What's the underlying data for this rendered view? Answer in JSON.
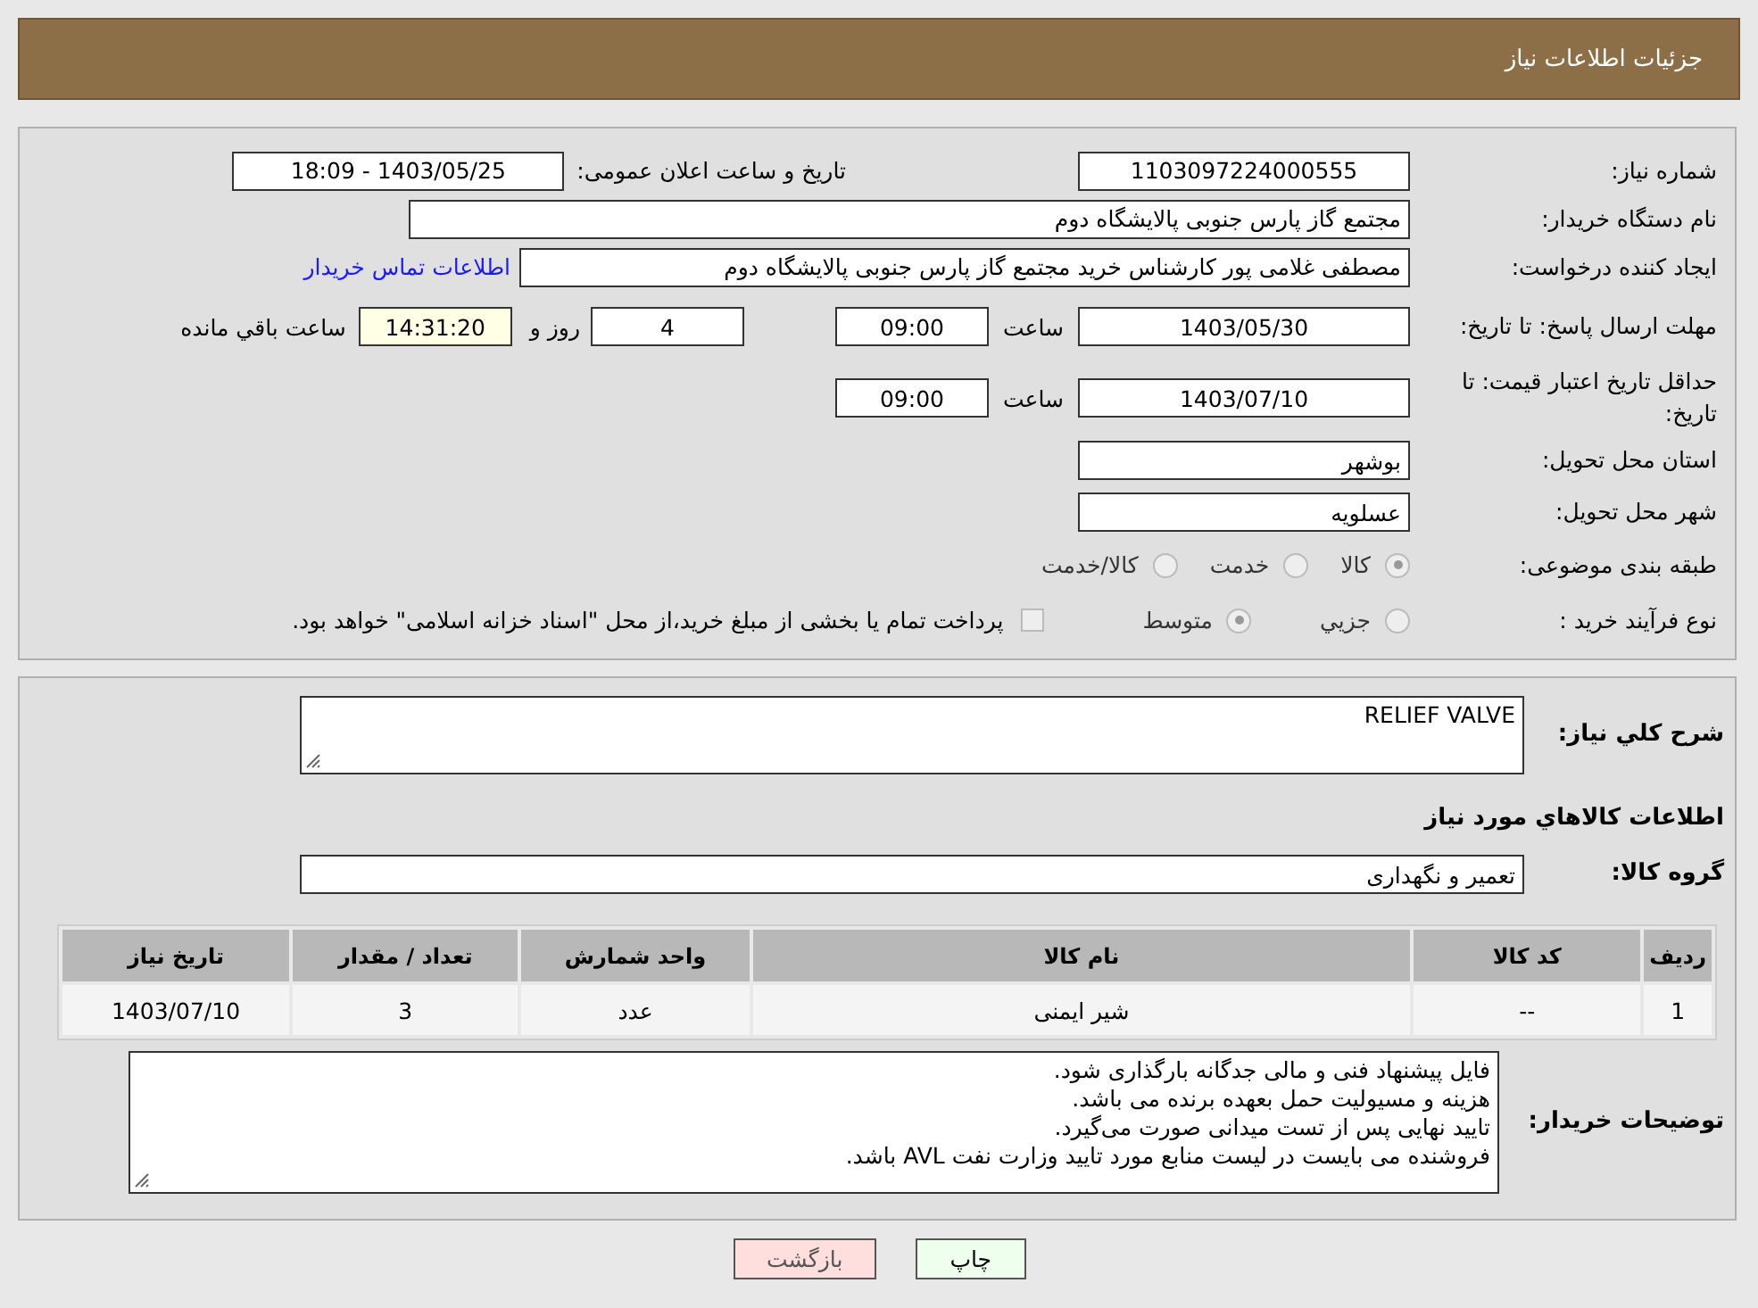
{
  "header": {
    "title": "جزئیات اطلاعات نیاز"
  },
  "details": {
    "need_number": {
      "label": "شماره نیاز:",
      "value": "1103097224000555"
    },
    "announce": {
      "label": "تاریخ و ساعت اعلان عمومی:",
      "value": "1403/05/25 - 18:09"
    },
    "buyer": {
      "label": "نام دستگاه خریدار:",
      "value": "مجتمع گاز پارس جنوبی  پالایشگاه دوم"
    },
    "creator": {
      "label": "ایجاد کننده درخواست:",
      "value": "مصطفی غلامی پور کارشناس خرید مجتمع گاز پارس جنوبی  پالایشگاه دوم",
      "link": "اطلاعات تماس خریدار"
    },
    "deadline": {
      "label": "مهلت ارسال پاسخ: تا تاریخ:",
      "date": "1403/05/30",
      "time_label": "ساعت",
      "time": "09:00",
      "days": "4",
      "days_label": "روز و",
      "remaining": "14:31:20",
      "remaining_label": "ساعت باقي مانده"
    },
    "validity": {
      "label": "حداقل تاریخ اعتبار قیمت: تا تاریخ:",
      "date": "1403/07/10",
      "time_label": "ساعت",
      "time": "09:00"
    },
    "province": {
      "label": "استان محل تحویل:",
      "value": "بوشهر"
    },
    "city": {
      "label": "شهر محل تحویل:",
      "value": "عسلویه"
    },
    "category": {
      "label": "طبقه بندی موضوعی:",
      "options": [
        {
          "label": "کالا",
          "selected": true
        },
        {
          "label": "خدمت",
          "selected": false
        },
        {
          "label": "کالا/خدمت",
          "selected": false
        }
      ]
    },
    "process": {
      "label": "نوع فرآیند خرید :",
      "options": [
        {
          "label": "جزيي",
          "selected": false
        },
        {
          "label": "متوسط",
          "selected": true
        }
      ],
      "treasury": {
        "checked": false,
        "text": "پرداخت تمام یا بخشی از مبلغ خرید،از محل \"اسناد خزانه اسلامی\" خواهد بود."
      }
    }
  },
  "goods": {
    "summary": {
      "label": "شرح کلي نیاز:",
      "value": "RELIEF VALVE"
    },
    "heading": "اطلاعات کالاهاي مورد نیاز",
    "group": {
      "label": "گروه کالا:",
      "value": "تعمیر و نگهداری"
    },
    "table": {
      "columns": [
        "ردیف",
        "کد کالا",
        "نام کالا",
        "واحد شمارش",
        "تعداد / مقدار",
        "تاریخ نیاز"
      ],
      "rows": [
        [
          "1",
          "--",
          "شیر ایمنی",
          "عدد",
          "3",
          "1403/07/10"
        ]
      ]
    },
    "notes": {
      "label": "توضیحات خریدار:",
      "lines": [
        "فایل پیشنهاد فنی و مالی جدگانه بارگذاری شود.",
        "هزینه و مسیولیت حمل بعهده برنده می باشد.",
        "تایید نهایی پس از تست میدانی صورت می‌گیرد.",
        "فروشنده می بایست در لیست منابع مورد تایید وزارت نفت AVL باشد."
      ]
    }
  },
  "buttons": [
    {
      "label": "چاپ",
      "kind": "print"
    },
    {
      "label": "بازگشت",
      "kind": "back"
    }
  ]
}
